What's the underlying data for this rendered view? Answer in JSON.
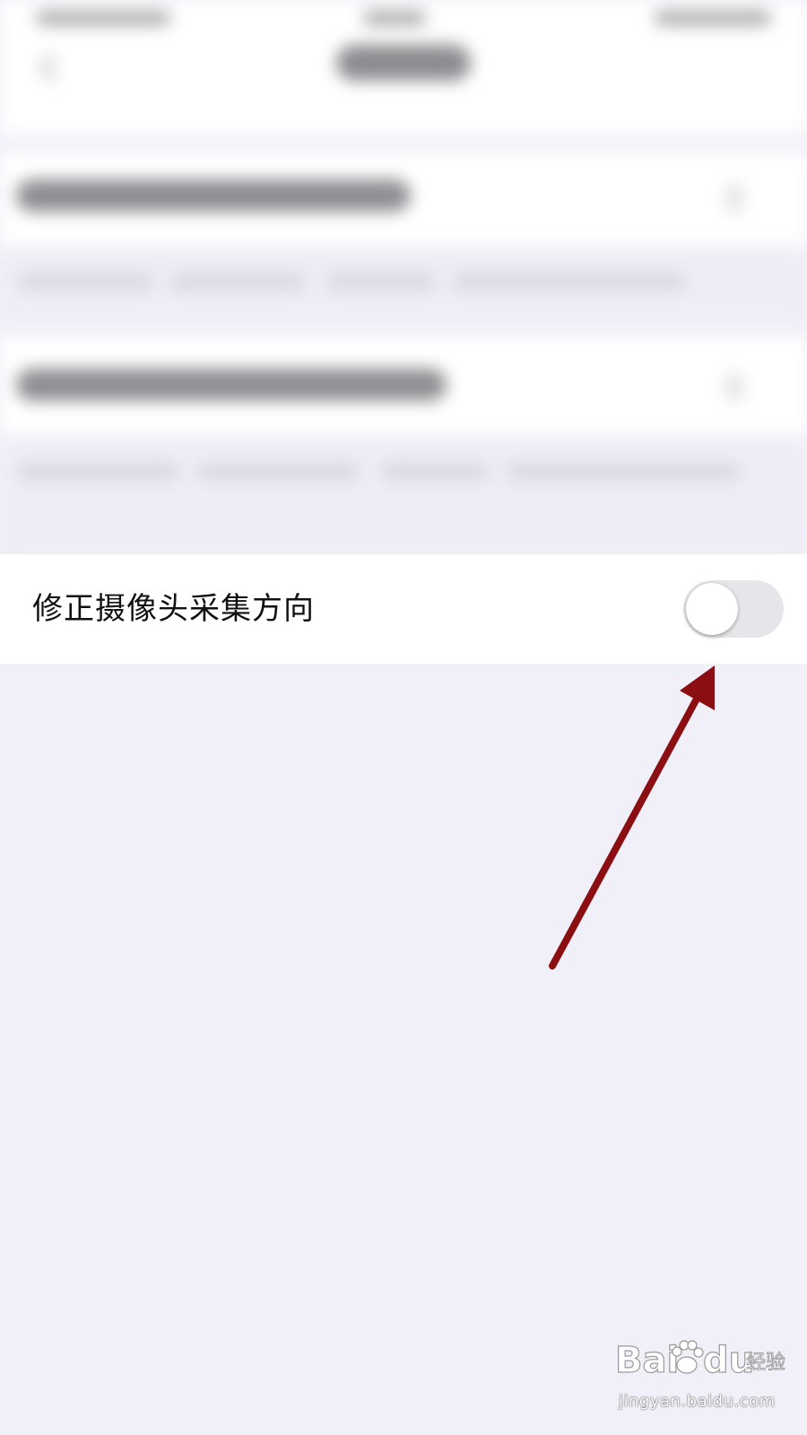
{
  "setting": {
    "label": "修正摄像头采集方向",
    "toggle_on": false
  },
  "watermark": {
    "logo_text": "Bai du 经验",
    "url": "jingyan.baidu.com"
  },
  "colors": {
    "background": "#f1f0f8",
    "row_background": "#ffffff",
    "toggle_track_off": "#e6e6ea",
    "annotation_arrow": "#8b0f12"
  },
  "icons": [
    "back-icon",
    "chevron-right-icon",
    "paw-icon"
  ]
}
